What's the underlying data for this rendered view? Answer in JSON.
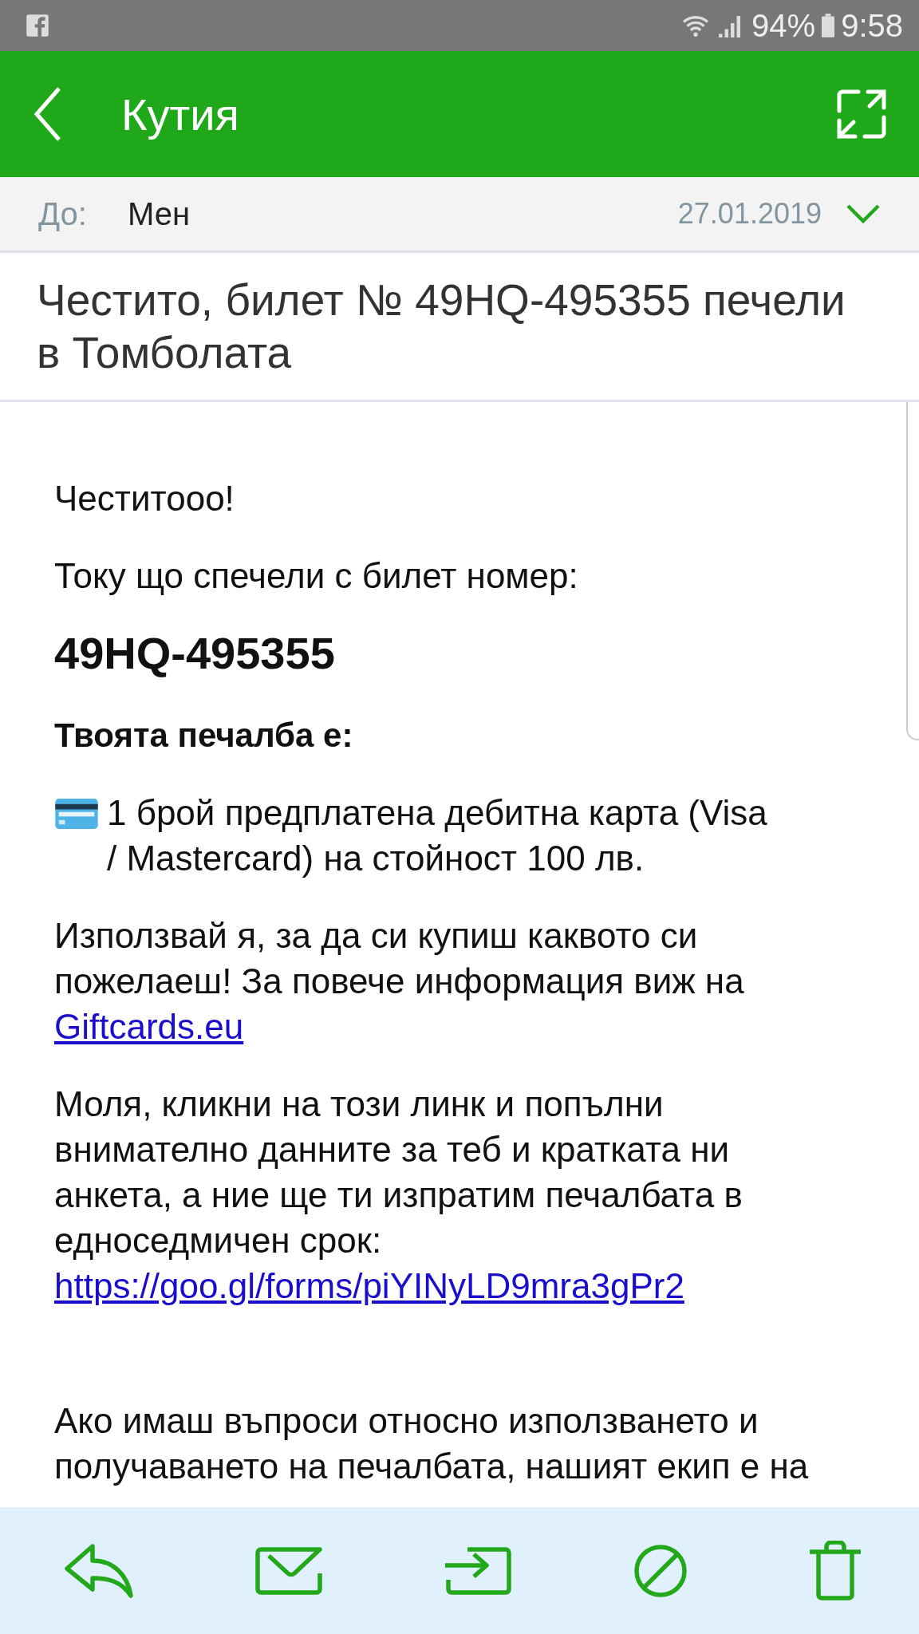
{
  "status_bar": {
    "battery": "94%",
    "time": "9:58"
  },
  "app_bar": {
    "title": "Кутия"
  },
  "header": {
    "to_label": "До:",
    "to_value": "Мен",
    "date": "27.01.2019"
  },
  "subject": "Честито, билет № 49HQ-495355 печели в Томболата",
  "body": [
    {
      "kind": "text",
      "text": "Честитооо!"
    },
    {
      "kind": "text",
      "text": "Току що спечели с билет номер:"
    },
    {
      "kind": "ticket",
      "text": "49HQ-495355"
    },
    {
      "kind": "strong",
      "text": "Твоята печалба е:"
    },
    {
      "kind": "card",
      "text": "1 брой предплатена дебитна карта (Visa / Mastercard) на стойност 100 лв."
    },
    {
      "kind": "text",
      "text": "Използвай я, за да си купиш каквото си пожелаеш! За повече информация виж на",
      "link": "Giftcards.eu"
    },
    {
      "kind": "text",
      "text": "Моля, кликни на този линк и попълни внимателно данните за теб и кратката ни анкета, а ние ще ти изпратим печалбата в едноседмичен срок:",
      "link": "https://goo.gl/forms/piYINyLD9mra3gPr2"
    },
    {
      "kind": "closing",
      "text": "Ако имаш въпроси относно използването и получаването на печалбата, нашият екип е на"
    }
  ]
}
